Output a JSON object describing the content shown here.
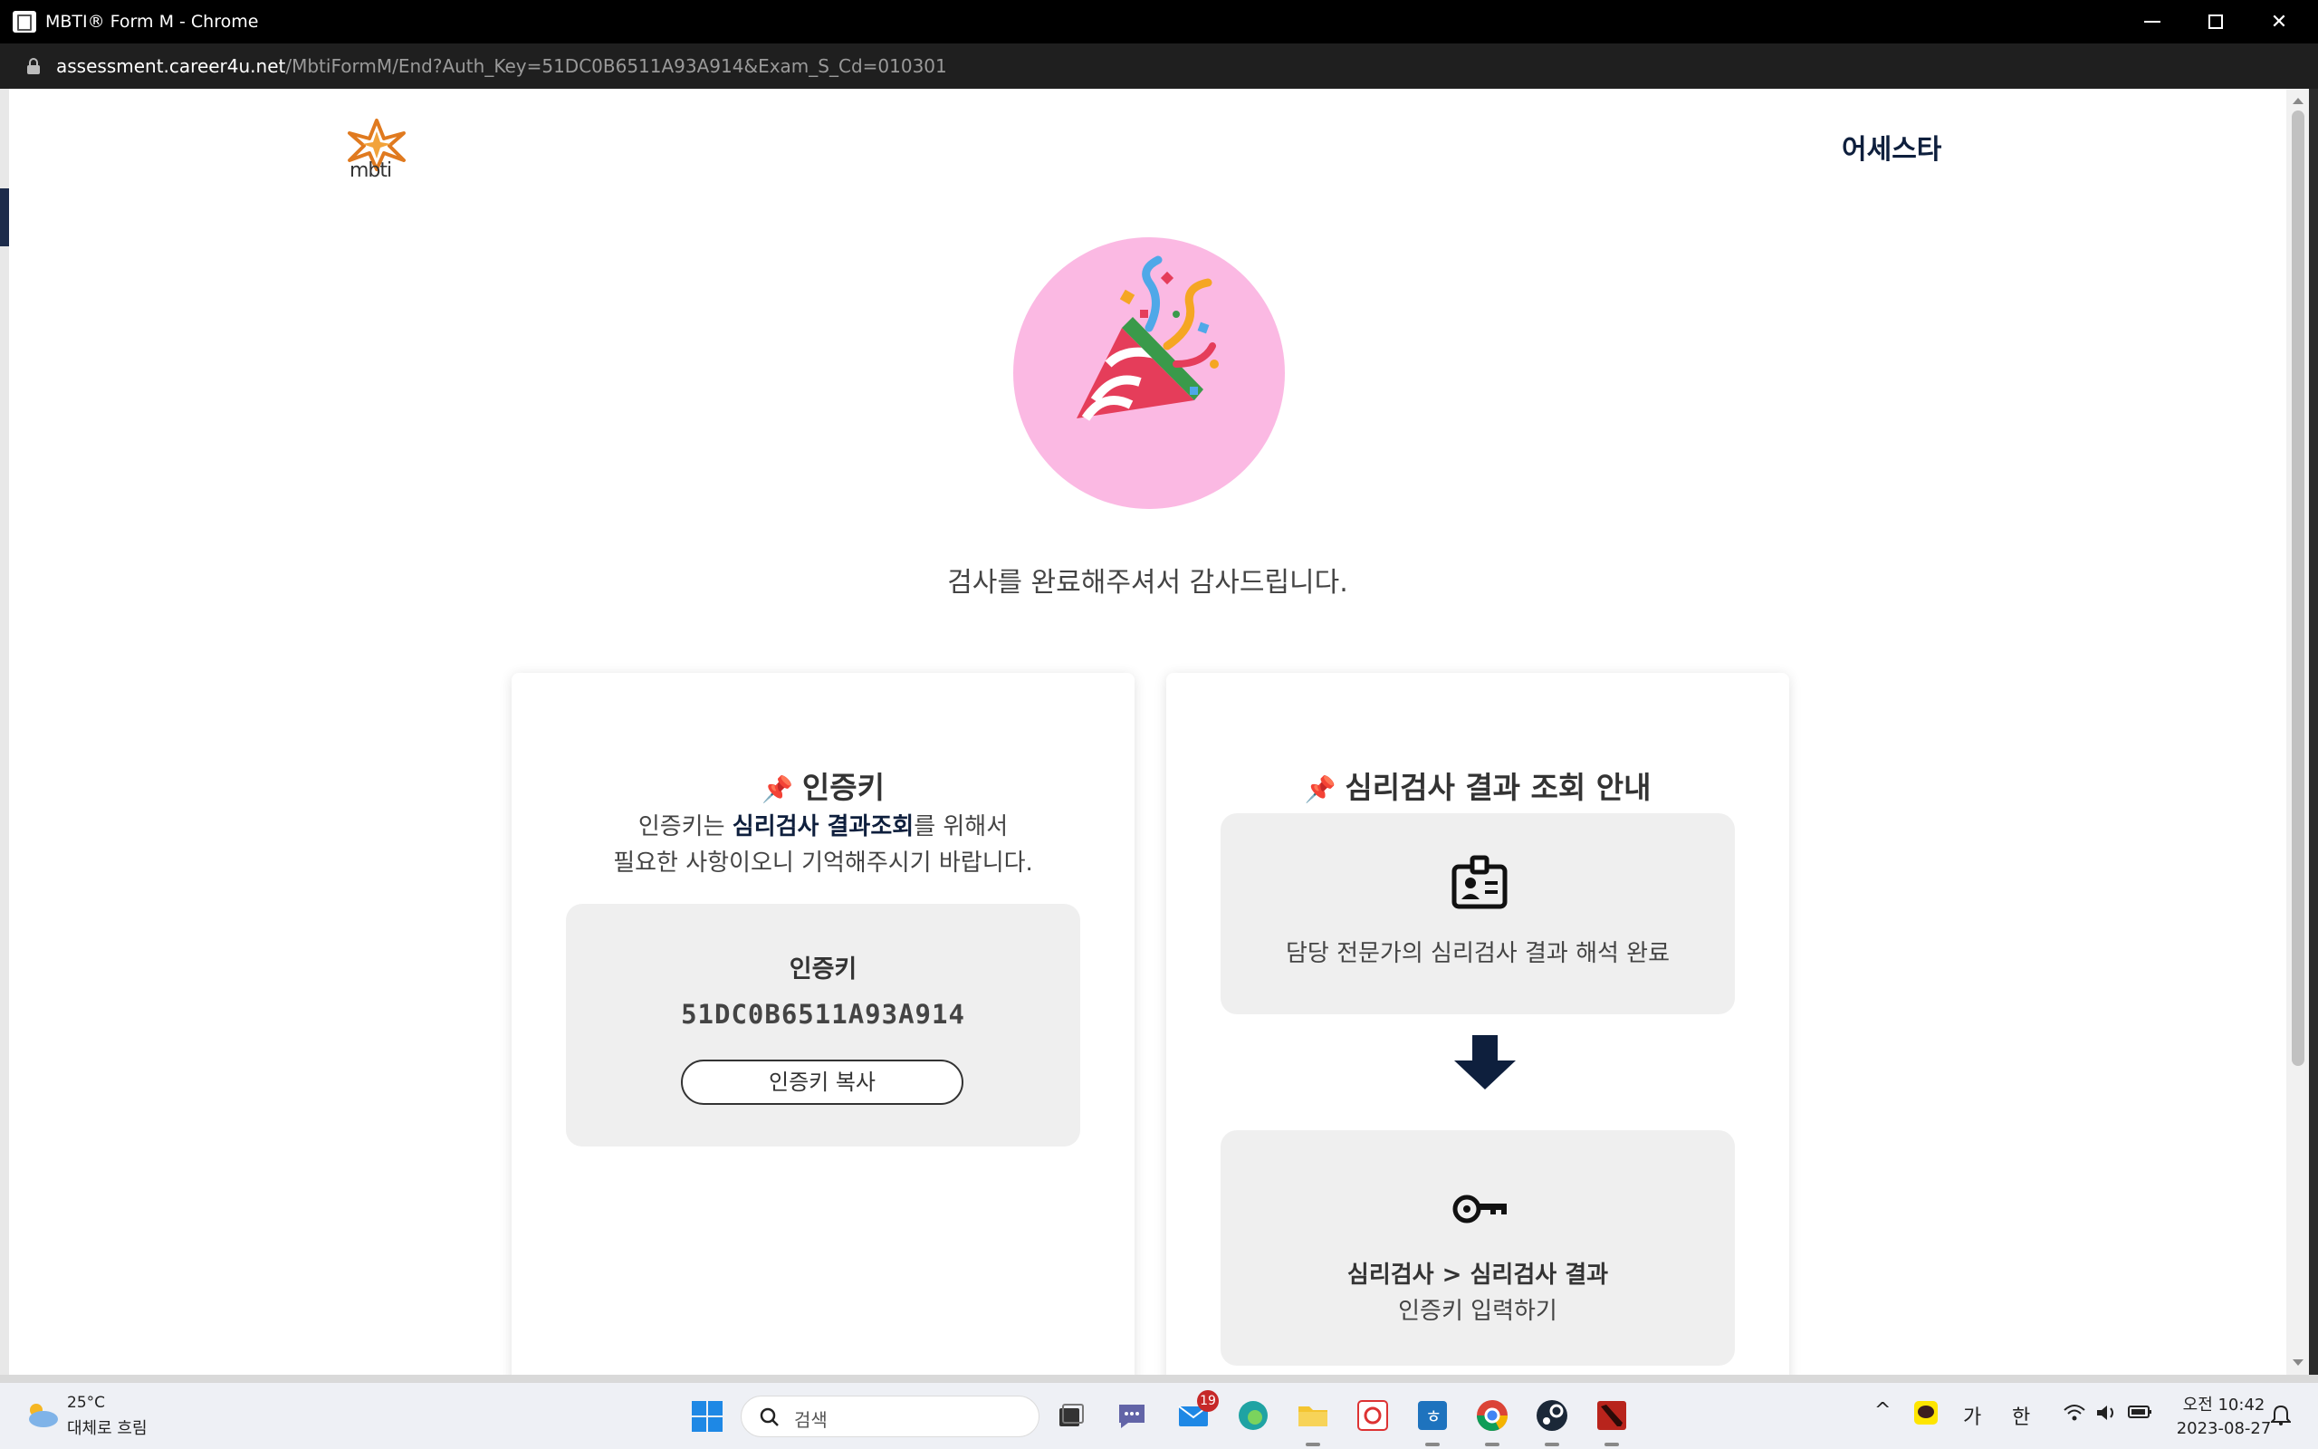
{
  "window": {
    "title": "MBTI® Form M - Chrome"
  },
  "address": {
    "host": "assessment.career4u.net",
    "path": "/MbtiFormM/End?Auth_Key=51DC0B6511A93A914&Exam_S_Cd=010301"
  },
  "header": {
    "logo_text": "mbti",
    "brand": "어세스타"
  },
  "main": {
    "thanks": "검사를 완료해주셔서 감사드립니다."
  },
  "auth_card": {
    "title": "인증키",
    "desc_pre": "인증키는 ",
    "desc_em": "심리검사 결과조회",
    "desc_post": "를 위해서",
    "desc_line2": "필요한 사항이오니 기억해주시기 바랍니다.",
    "key_label": "인증키",
    "key_value": "51DC0B6511A93A914",
    "copy_button": "인증키 복사"
  },
  "guide_card": {
    "title": "심리검사 결과 조회 안내",
    "step1": "담당 전문가의 심리검사 결과 해석 완료",
    "step2_bold": "심리검사 > 심리검사 결과",
    "step2": "인증키 입력하기"
  },
  "taskbar": {
    "weather_temp": "25°C",
    "weather_cond": "대체로 흐림",
    "search_placeholder": "검색",
    "mail_badge": "19",
    "ime_ga": "가",
    "ime_han": "한",
    "time": "오전 10:42",
    "date": "2023-08-27"
  },
  "colors": {
    "brand_navy": "#0e1f3d",
    "celebrate_bg": "#fbb9e3",
    "card_box": "#efefef"
  },
  "icons": [
    "lock-icon",
    "pushpin-icon",
    "id-badge-icon",
    "down-arrow-icon",
    "key-icon",
    "party-popper-icon",
    "mbti-logo-icon"
  ]
}
